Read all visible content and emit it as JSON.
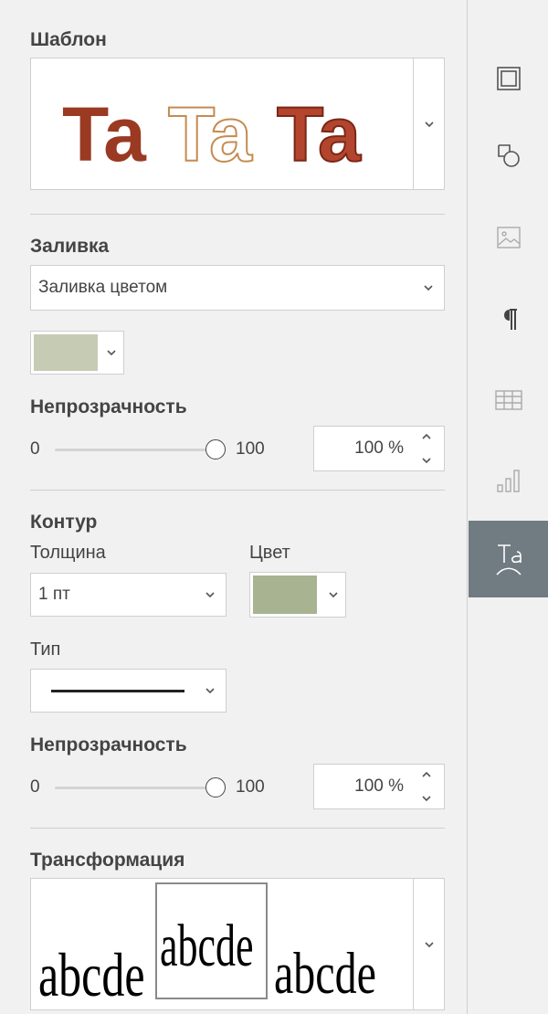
{
  "template": {
    "title": "Шаблон",
    "samples": [
      {
        "text": "Ta",
        "style": "solid-brown"
      },
      {
        "text": "Ta",
        "style": "outline-tan"
      },
      {
        "text": "Ta",
        "style": "red-outline"
      }
    ]
  },
  "fill": {
    "title": "Заливка",
    "type_value": "Заливка цветом",
    "color": "#c6cbb4",
    "opacity": {
      "title": "Непрозрачность",
      "min_label": "0",
      "max_label": "100",
      "value": "100 %",
      "level": 100
    }
  },
  "outline": {
    "title": "Контур",
    "width_label": "Толщина",
    "width_value": "1 пт",
    "color_label": "Цвет",
    "color": "#a7b391",
    "type_label": "Тип",
    "opacity": {
      "title": "Непрозрачность",
      "min_label": "0",
      "max_label": "100",
      "value": "100 %",
      "level": 100
    }
  },
  "transform": {
    "title": "Трансформация",
    "samples": [
      "abcde",
      "abcde",
      "abcde"
    ]
  },
  "rail": {
    "items": [
      {
        "icon": "slide-settings-icon",
        "active": false
      },
      {
        "icon": "shape-settings-icon",
        "active": false
      },
      {
        "icon": "image-settings-icon",
        "active": false
      },
      {
        "icon": "paragraph-settings-icon",
        "active": false
      },
      {
        "icon": "table-settings-icon",
        "active": false
      },
      {
        "icon": "chart-settings-icon",
        "active": false
      },
      {
        "icon": "textart-settings-icon",
        "active": true
      }
    ]
  },
  "colors": {
    "panel_bg": "#f1f1f1",
    "rail_active": "#717b82",
    "template_brown": "#9a3a22",
    "template_tan": "#c58b4f",
    "template_red": "#b3452f"
  }
}
